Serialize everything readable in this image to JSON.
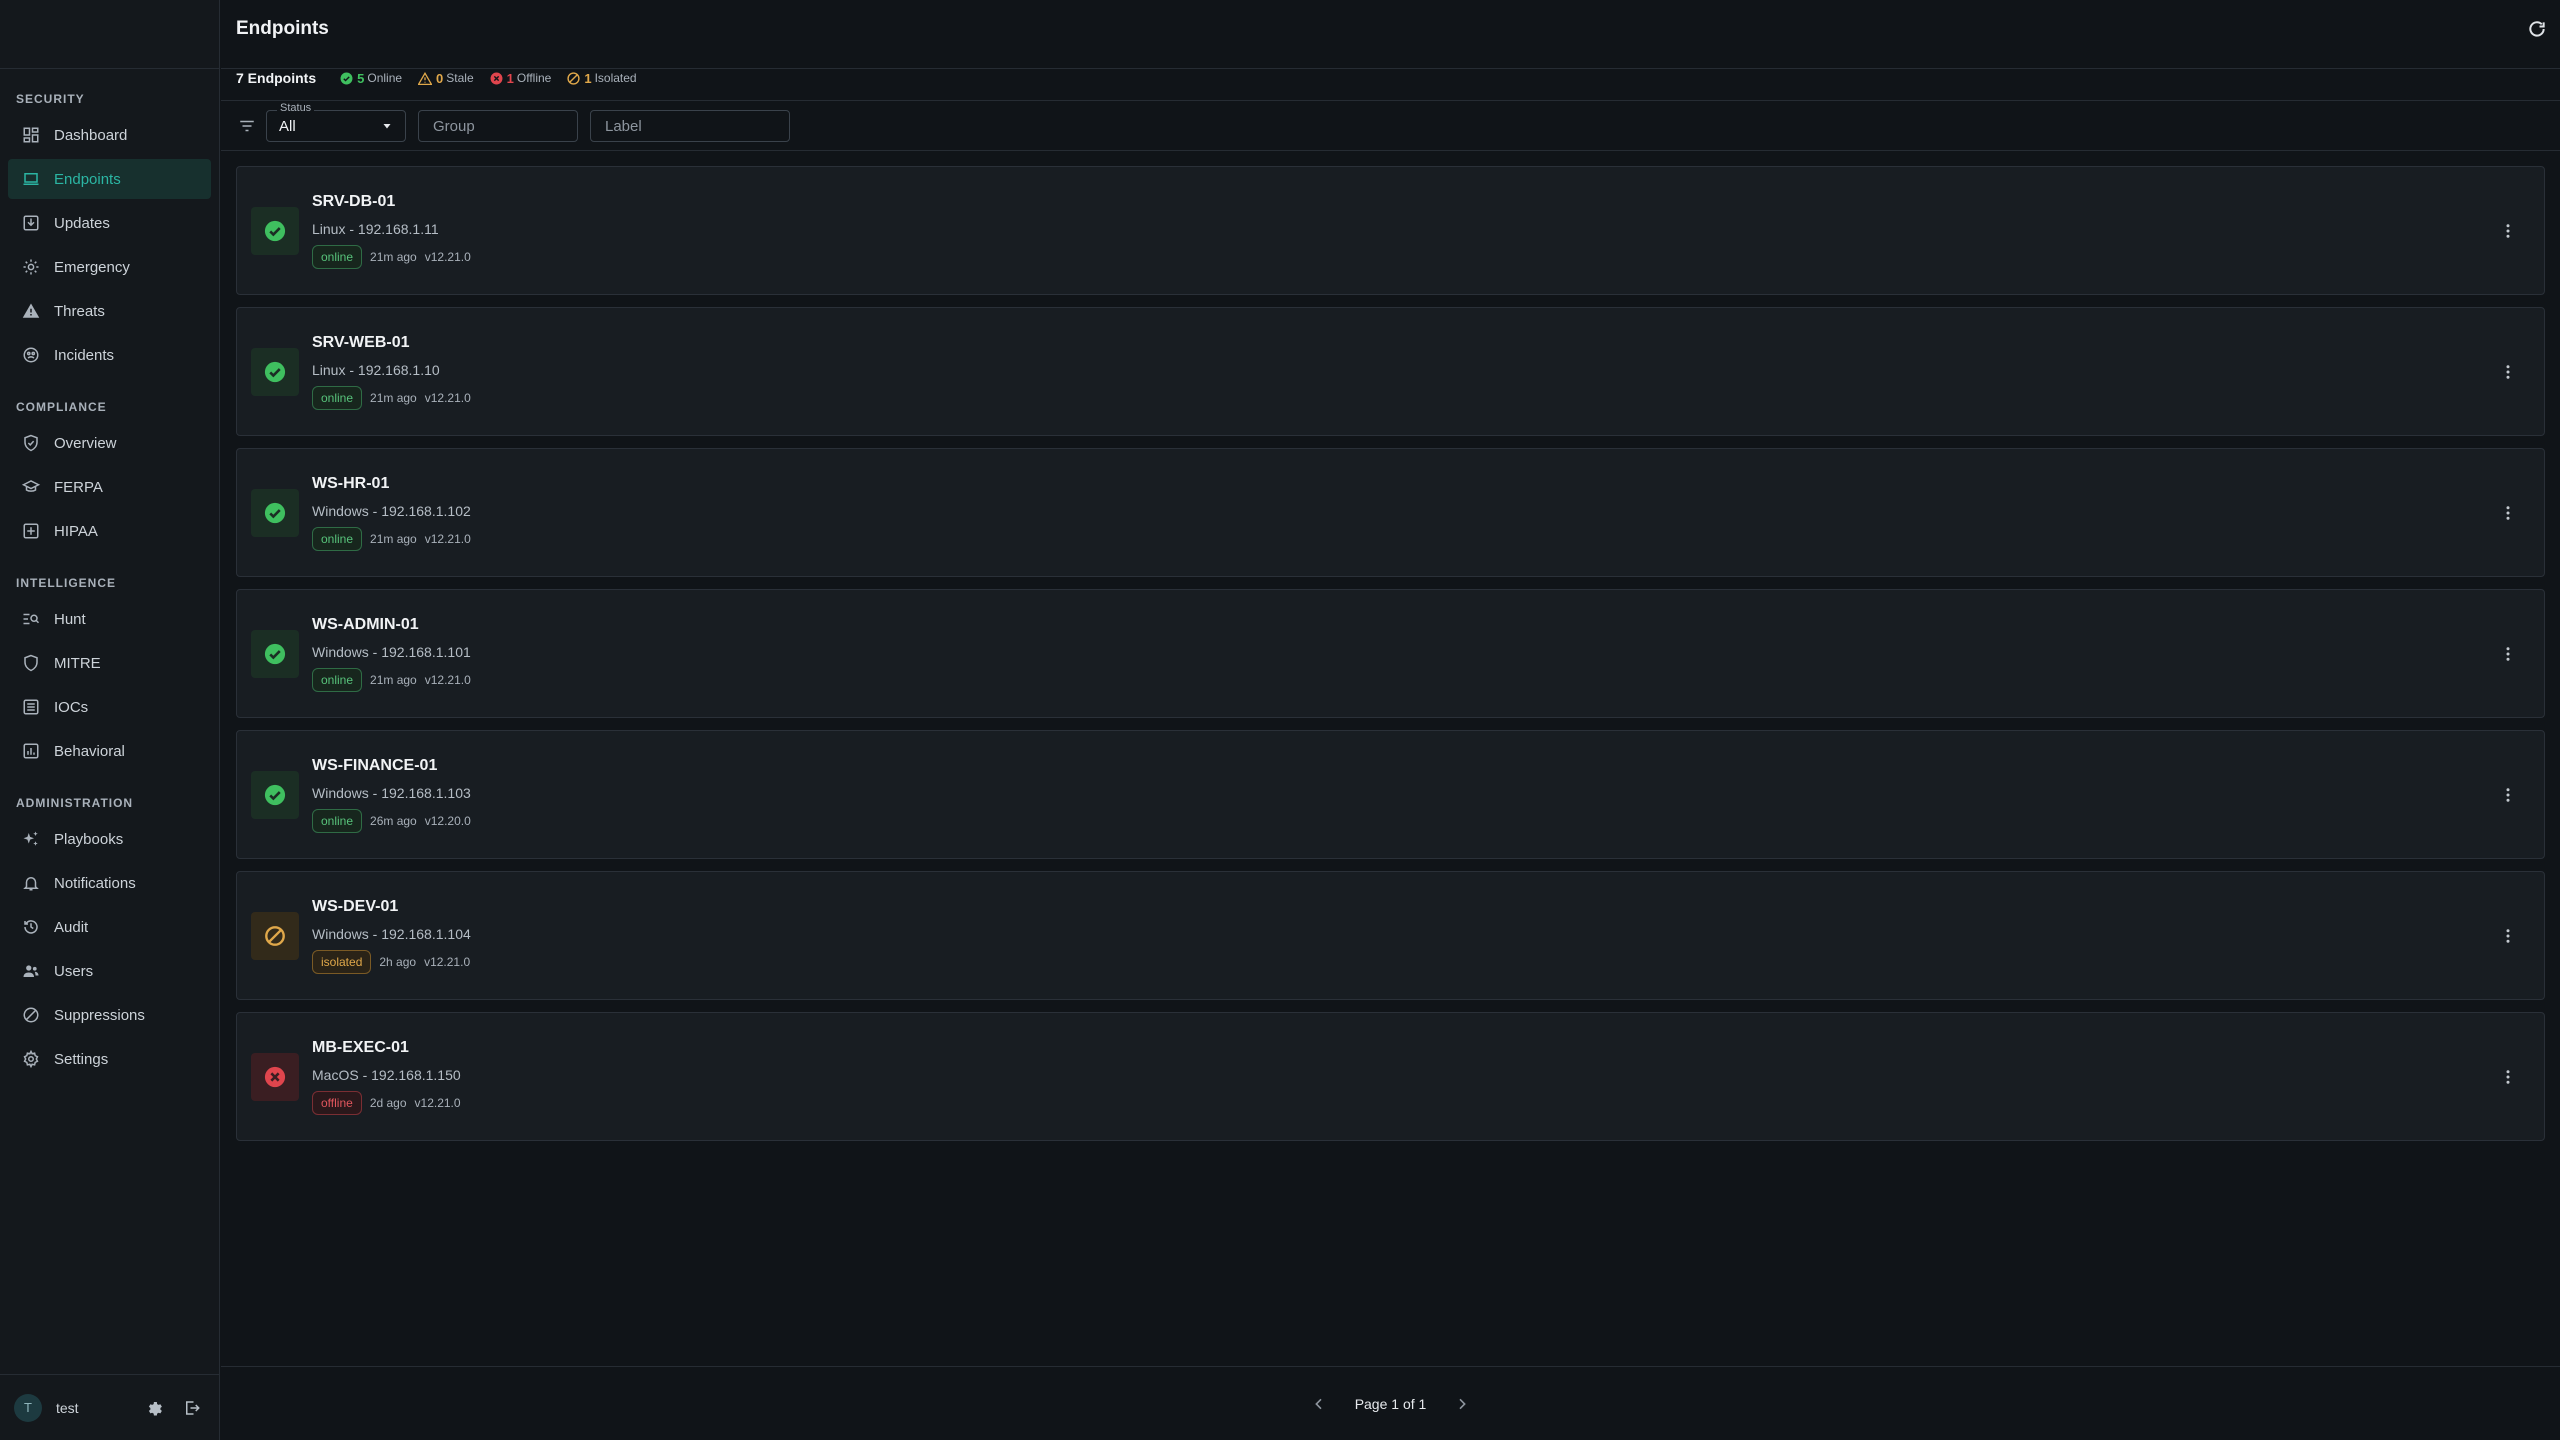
{
  "page": {
    "title": "Endpoints"
  },
  "summary": {
    "total": "7 Endpoints",
    "online": {
      "count": "5",
      "label": "Online"
    },
    "stale": {
      "count": "0",
      "label": "Stale"
    },
    "offline": {
      "count": "1",
      "label": "Offline"
    },
    "isolated": {
      "count": "1",
      "label": "Isolated"
    }
  },
  "filters": {
    "status_label": "Status",
    "status_value": "All",
    "group_placeholder": "Group",
    "label_placeholder": "Label"
  },
  "sidebar": {
    "sections": [
      {
        "title": "SECURITY",
        "items": [
          {
            "label": "Dashboard",
            "icon": "dashboard-icon"
          },
          {
            "label": "Endpoints",
            "icon": "laptop-icon",
            "active": true
          },
          {
            "label": "Updates",
            "icon": "download-box-icon"
          },
          {
            "label": "Emergency",
            "icon": "gear-alert-icon"
          },
          {
            "label": "Threats",
            "icon": "warning-triangle-icon"
          },
          {
            "label": "Incidents",
            "icon": "biohazard-icon"
          }
        ]
      },
      {
        "title": "COMPLIANCE",
        "items": [
          {
            "label": "Overview",
            "icon": "shield-check-icon"
          },
          {
            "label": "FERPA",
            "icon": "graduation-cap-icon"
          },
          {
            "label": "HIPAA",
            "icon": "medical-plus-icon"
          }
        ]
      },
      {
        "title": "INTELLIGENCE",
        "items": [
          {
            "label": "Hunt",
            "icon": "search-list-icon"
          },
          {
            "label": "MITRE",
            "icon": "shield-icon"
          },
          {
            "label": "IOCs",
            "icon": "list-box-icon"
          },
          {
            "label": "Behavioral",
            "icon": "chart-box-icon"
          }
        ]
      },
      {
        "title": "ADMINISTRATION",
        "items": [
          {
            "label": "Playbooks",
            "icon": "sparkles-icon"
          },
          {
            "label": "Notifications",
            "icon": "bell-icon"
          },
          {
            "label": "Audit",
            "icon": "history-icon"
          },
          {
            "label": "Users",
            "icon": "users-icon"
          },
          {
            "label": "Suppressions",
            "icon": "block-icon"
          },
          {
            "label": "Settings",
            "icon": "gear-icon"
          }
        ]
      }
    ],
    "user": {
      "initial": "T",
      "name": "test"
    }
  },
  "endpoints": [
    {
      "name": "SRV-DB-01",
      "subtitle": "Linux - 192.168.1.11",
      "status": "online",
      "last_seen": "21m ago",
      "version": "v12.21.0"
    },
    {
      "name": "SRV-WEB-01",
      "subtitle": "Linux - 192.168.1.10",
      "status": "online",
      "last_seen": "21m ago",
      "version": "v12.21.0"
    },
    {
      "name": "WS-HR-01",
      "subtitle": "Windows - 192.168.1.102",
      "status": "online",
      "last_seen": "21m ago",
      "version": "v12.21.0"
    },
    {
      "name": "WS-ADMIN-01",
      "subtitle": "Windows - 192.168.1.101",
      "status": "online",
      "last_seen": "21m ago",
      "version": "v12.21.0"
    },
    {
      "name": "WS-FINANCE-01",
      "subtitle": "Windows - 192.168.1.103",
      "status": "online",
      "last_seen": "26m ago",
      "version": "v12.20.0"
    },
    {
      "name": "WS-DEV-01",
      "subtitle": "Windows - 192.168.1.104",
      "status": "isolated",
      "last_seen": "2h ago",
      "version": "v12.21.0"
    },
    {
      "name": "MB-EXEC-01",
      "subtitle": "MacOS - 192.168.1.150",
      "status": "offline",
      "last_seen": "2d ago",
      "version": "v12.21.0"
    }
  ],
  "pagination": {
    "text": "Page 1 of 1"
  },
  "colors": {
    "accent": "#2bb5a3",
    "online": "#3fbf5f",
    "isolated": "#e0a84a",
    "offline": "#e0454d"
  }
}
